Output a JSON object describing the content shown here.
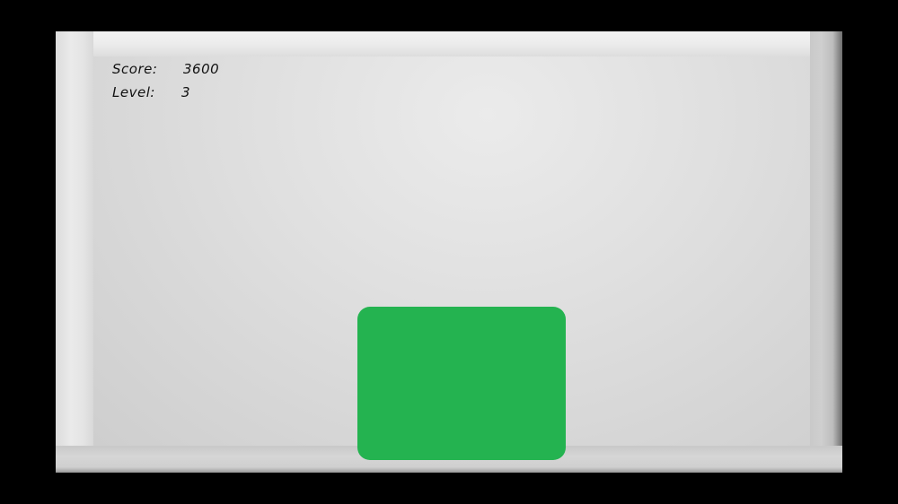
{
  "hud": {
    "score_label": "Score:",
    "score_value": "3600",
    "level_label": "Level:",
    "level_value": "3"
  },
  "colors": {
    "background": "#000000",
    "board": "#e0e0e0",
    "block": "#24b350",
    "text": "#111111"
  }
}
